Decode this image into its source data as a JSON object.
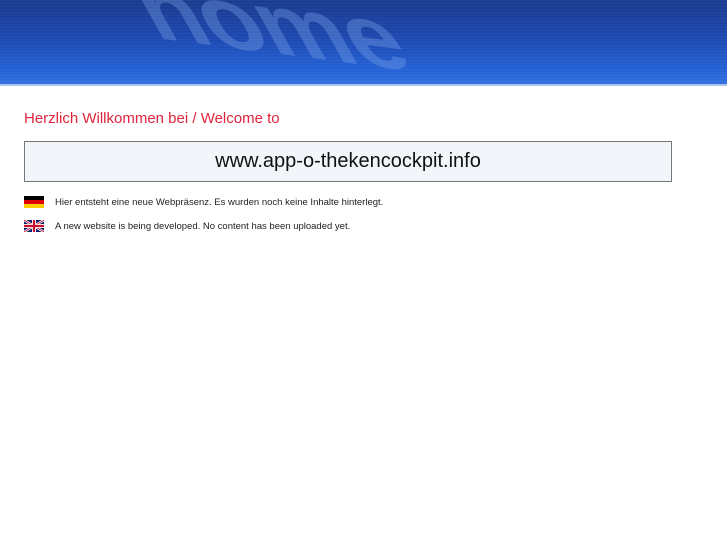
{
  "header": {
    "watermark": "home"
  },
  "welcome": "Herzlich Willkommen bei / Welcome to",
  "domain": "www.app-o-thekencockpit.info",
  "messages": [
    {
      "flag": "german-flag-icon",
      "text": "Hier entsteht eine neue Webpräsenz. Es wurden noch keine Inhalte hinterlegt."
    },
    {
      "flag": "uk-flag-icon",
      "text": "A new website is being developed. No content has been uploaded yet."
    }
  ]
}
